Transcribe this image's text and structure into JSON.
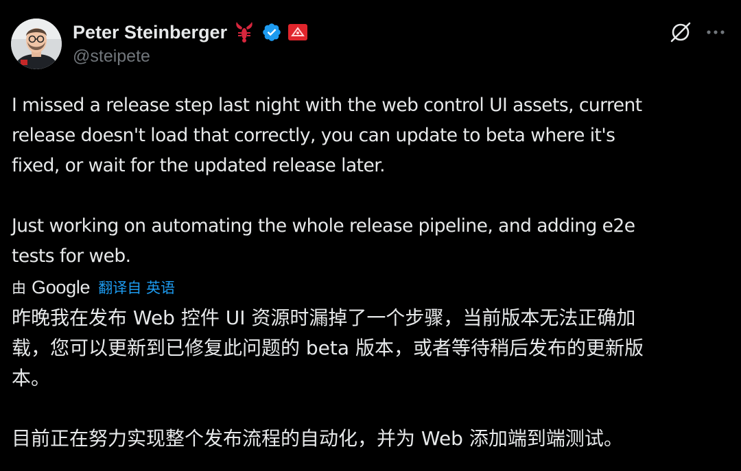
{
  "author": {
    "display_name": "Peter Steinberger",
    "handle": "@steipete",
    "badges": [
      "lobster-emoji",
      "verified-icon",
      "red-flag-emoji"
    ],
    "verified_color": "#1d9bf0"
  },
  "header_actions": {
    "grok_icon": "grok-icon",
    "more_icon": "more-icon"
  },
  "post": {
    "paragraph1_lines": [
      "I missed a release step last night with the web control UI assets, current",
      "release doesn't load that correctly, you can update to beta where it's",
      "fixed, or wait for the updated release later."
    ],
    "paragraph2_lines": [
      "Just working on automating the whole release pipeline, and adding e2e",
      "tests for web."
    ]
  },
  "translation": {
    "by_label": "由",
    "provider": "Google",
    "translated_from": "翻译自 英语",
    "paragraph1_lines": [
      "昨晚我在发布 Web 控件 UI 资源时漏掉了一个步骤，当前版本无法正确加",
      "载，您可以更新到已修复此问题的 beta 版本，或者等待稍后发布的更新版",
      "本。"
    ],
    "paragraph2_lines": [
      "目前正在努力实现整个发布流程的自动化，并为 Web 添加端到端测试。"
    ]
  },
  "colors": {
    "background": "#000000",
    "text": "#e7e9ea",
    "muted": "#71767b",
    "link": "#1d9bf0"
  }
}
